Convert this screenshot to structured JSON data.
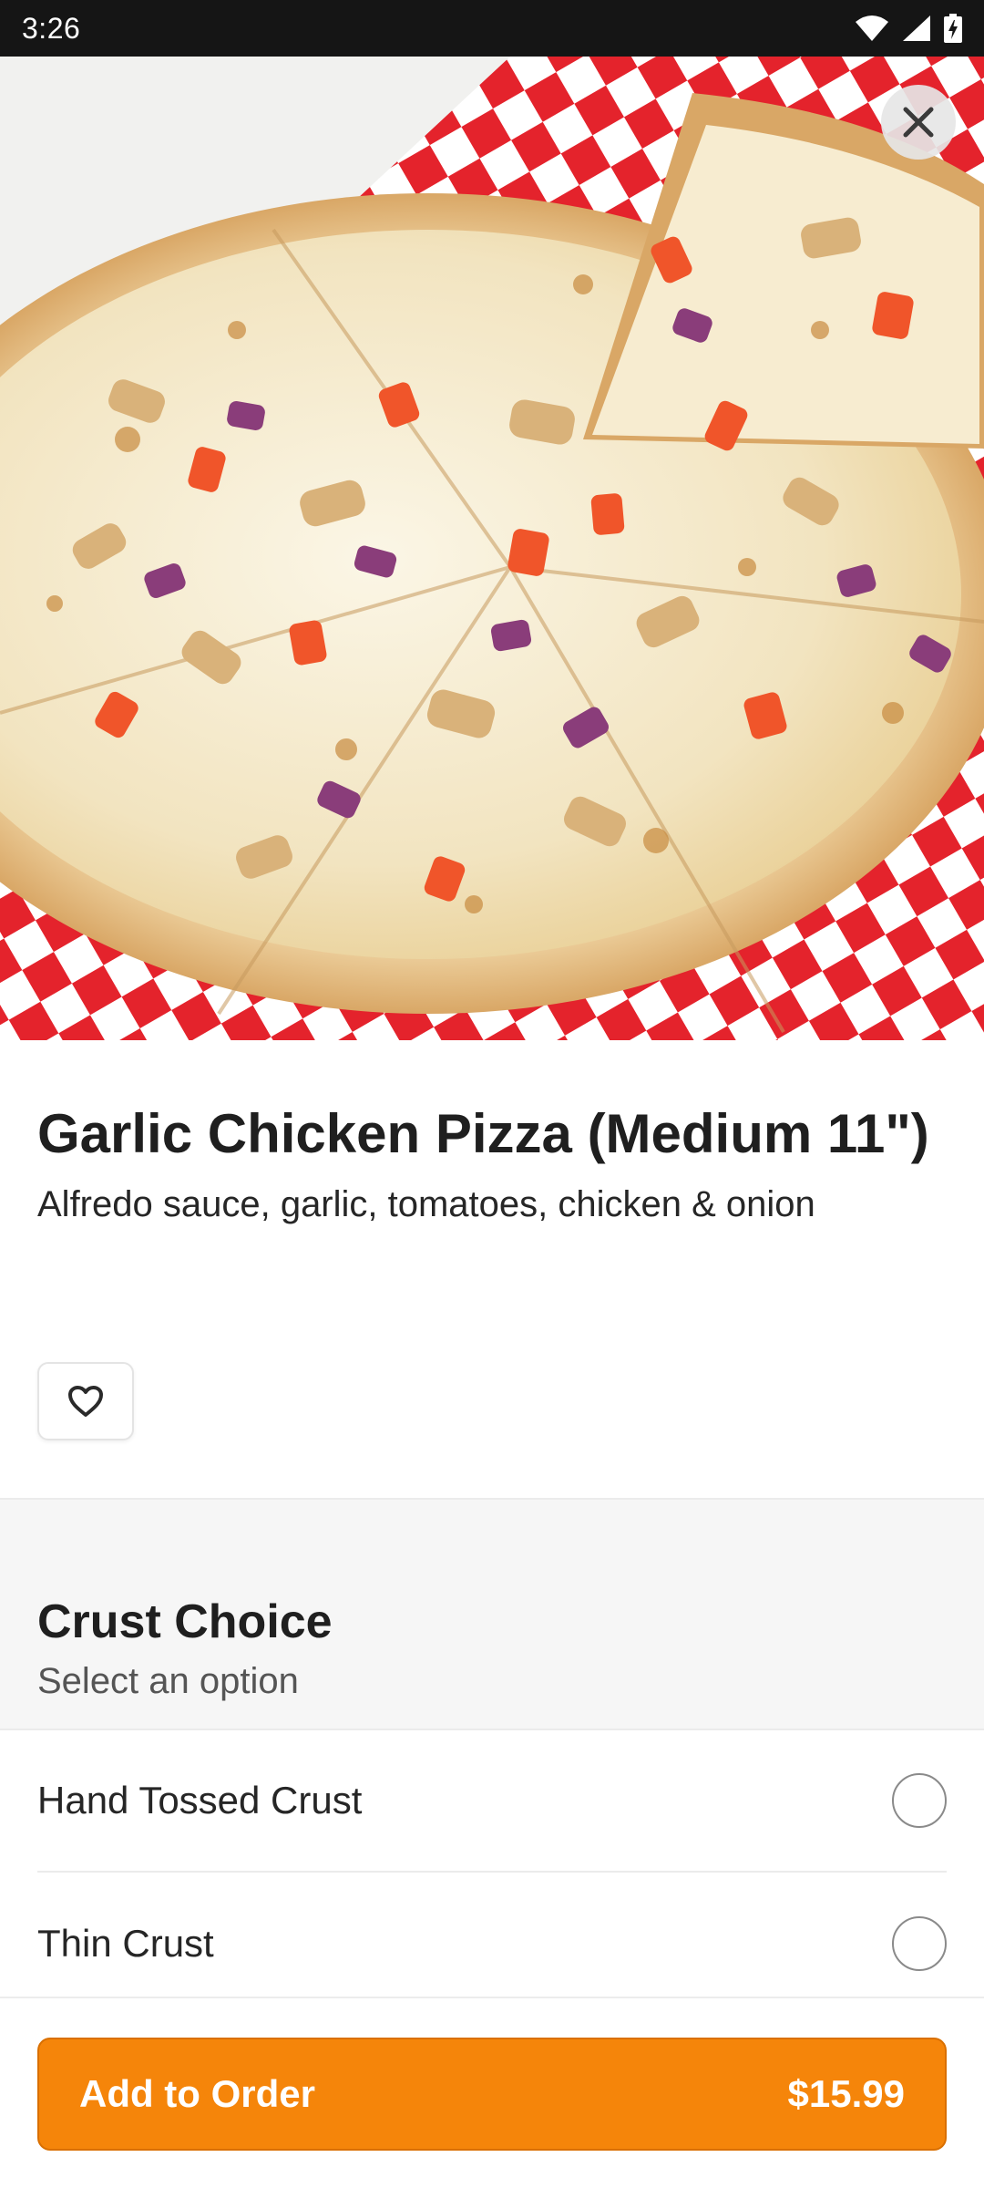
{
  "status_bar": {
    "time": "3:26",
    "icons": [
      "wifi-icon",
      "signal-icon",
      "battery-charging-icon"
    ]
  },
  "hero": {
    "image": "garlic-chicken-pizza-photo",
    "close_icon": "close-icon"
  },
  "product": {
    "title": "Garlic Chicken Pizza (Medium 11\")",
    "description": "Alfredo sauce, garlic, tomatoes, chicken & onion",
    "favorite_icon": "heart-outline-icon"
  },
  "option_group": {
    "title": "Crust Choice",
    "subtitle": "Select an option",
    "options": [
      {
        "label": "Hand Tossed Crust",
        "selected": false
      },
      {
        "label": "Thin Crust",
        "selected": false
      }
    ]
  },
  "order": {
    "button_label": "Add to Order",
    "price": "$15.99"
  },
  "colors": {
    "accent": "#f5850a",
    "status_bar": "#151515",
    "section_bg": "#f6f6f6"
  }
}
